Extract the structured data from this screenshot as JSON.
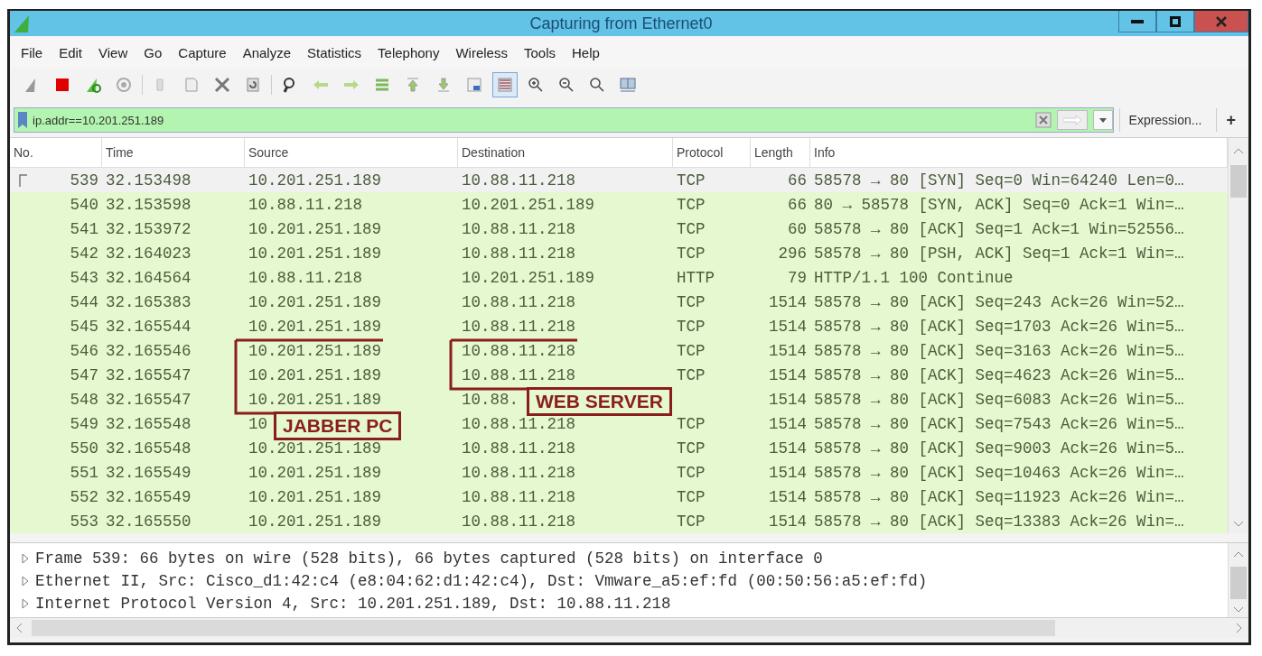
{
  "window": {
    "title": "Capturing from Ethernet0"
  },
  "menu": [
    "File",
    "Edit",
    "View",
    "Go",
    "Capture",
    "Analyze",
    "Statistics",
    "Telephony",
    "Wireless",
    "Tools",
    "Help"
  ],
  "toolbar": [
    {
      "kind": "fin",
      "pressed": false
    },
    {
      "kind": "stop",
      "pressed": false
    },
    {
      "kind": "restart",
      "pressed": false
    },
    {
      "kind": "options",
      "pressed": false
    },
    {
      "kind": "sep"
    },
    {
      "kind": "open",
      "pressed": false
    },
    {
      "kind": "save",
      "pressed": false
    },
    {
      "kind": "close",
      "pressed": false
    },
    {
      "kind": "reload",
      "pressed": false
    },
    {
      "kind": "sep"
    },
    {
      "kind": "find",
      "pressed": false
    },
    {
      "kind": "back",
      "pressed": false
    },
    {
      "kind": "forward",
      "pressed": false
    },
    {
      "kind": "goto",
      "pressed": false
    },
    {
      "kind": "first",
      "pressed": false
    },
    {
      "kind": "last",
      "pressed": false
    },
    {
      "kind": "autoscroll",
      "pressed": false
    },
    {
      "kind": "colorize",
      "pressed": true
    },
    {
      "kind": "zoom-in",
      "pressed": false
    },
    {
      "kind": "zoom-out",
      "pressed": false
    },
    {
      "kind": "zoom-reset",
      "pressed": false
    },
    {
      "kind": "resize",
      "pressed": false
    }
  ],
  "filter": {
    "value": "ip.addr==10.201.251.189",
    "expression_button": "Expression...",
    "add_button": "+"
  },
  "table": {
    "columns": [
      "No.",
      "Time",
      "Source",
      "Destination",
      "Protocol",
      "Length",
      "Info"
    ],
    "rows": [
      {
        "no": "539",
        "time": "32.153498",
        "source": "10.201.251.189",
        "destination": "10.88.11.218",
        "protocol": "TCP",
        "length": "66",
        "info": "58578 → 80 [SYN] Seq=0 Win=64240 Len=0…",
        "selected": true
      },
      {
        "no": "540",
        "time": "32.153598",
        "source": "10.88.11.218",
        "destination": "10.201.251.189",
        "protocol": "TCP",
        "length": "66",
        "info": "80 → 58578 [SYN, ACK] Seq=0 Ack=1 Win=…",
        "selected": false
      },
      {
        "no": "541",
        "time": "32.153972",
        "source": "10.201.251.189",
        "destination": "10.88.11.218",
        "protocol": "TCP",
        "length": "60",
        "info": "58578 → 80 [ACK] Seq=1 Ack=1 Win=52556…",
        "selected": false
      },
      {
        "no": "542",
        "time": "32.164023",
        "source": "10.201.251.189",
        "destination": "10.88.11.218",
        "protocol": "TCP",
        "length": "296",
        "info": "58578 → 80 [PSH, ACK] Seq=1 Ack=1 Win=…",
        "selected": false
      },
      {
        "no": "543",
        "time": "32.164564",
        "source": "10.88.11.218",
        "destination": "10.201.251.189",
        "protocol": "HTTP",
        "length": "79",
        "info": "HTTP/1.1 100 Continue",
        "selected": false
      },
      {
        "no": "544",
        "time": "32.165383",
        "source": "10.201.251.189",
        "destination": "10.88.11.218",
        "protocol": "TCP",
        "length": "1514",
        "info": "58578 → 80 [ACK] Seq=243 Ack=26 Win=52…",
        "selected": false
      },
      {
        "no": "545",
        "time": "32.165544",
        "source": "10.201.251.189",
        "destination": "10.88.11.218",
        "protocol": "TCP",
        "length": "1514",
        "info": "58578 → 80 [ACK] Seq=1703 Ack=26 Win=5…",
        "selected": false
      },
      {
        "no": "546",
        "time": "32.165546",
        "source": "10.201.251.189",
        "destination": "10.88.11.218",
        "protocol": "TCP",
        "length": "1514",
        "info": "58578 → 80 [ACK] Seq=3163 Ack=26 Win=5…",
        "selected": false
      },
      {
        "no": "547",
        "time": "32.165547",
        "source": "10.201.251.189",
        "destination": "10.88.11.218",
        "protocol": "TCP",
        "length": "1514",
        "info": "58578 → 80 [ACK] Seq=4623 Ack=26 Win=5…",
        "selected": false
      },
      {
        "no": "548",
        "time": "32.165547",
        "source": "10.201.251.189",
        "destination": "10.88.",
        "length": "1514",
        "info": "58578 → 80 [ACK] Seq=6083 Ack=26 Win=5…",
        "selected": false
      },
      {
        "no": "549",
        "time": "32.165548",
        "source": "10",
        "destination": "10.88.11.218",
        "protocol": "TCP",
        "length": "1514",
        "info": "58578 → 80 [ACK] Seq=7543 Ack=26 Win=5…",
        "selected": false
      },
      {
        "no": "550",
        "time": "32.165548",
        "source": "10.201.251.189",
        "destination": "10.88.11.218",
        "protocol": "TCP",
        "length": "1514",
        "info": "58578 → 80 [ACK] Seq=9003 Ack=26 Win=5…",
        "selected": false
      },
      {
        "no": "551",
        "time": "32.165549",
        "source": "10.201.251.189",
        "destination": "10.88.11.218",
        "protocol": "TCP",
        "length": "1514",
        "info": "58578 → 80 [ACK] Seq=10463 Ack=26 Win=…",
        "selected": false
      },
      {
        "no": "552",
        "time": "32.165549",
        "source": "10.201.251.189",
        "destination": "10.88.11.218",
        "protocol": "TCP",
        "length": "1514",
        "info": "58578 → 80 [ACK] Seq=11923 Ack=26 Win=…",
        "selected": false
      },
      {
        "no": "553",
        "time": "32.165550",
        "source": "10.201.251.189",
        "destination": "10.88.11.218",
        "protocol": "TCP",
        "length": "1514",
        "info": "58578 → 80 [ACK] Seq=13383 Ack=26 Win=…",
        "selected": false
      }
    ]
  },
  "annotations": [
    {
      "label": "JABBER PC"
    },
    {
      "label": "WEB SERVER"
    }
  ],
  "details": [
    {
      "text": "Frame 539: 66 bytes on wire (528 bits), 66 bytes captured (528 bits) on interface 0",
      "expanded": false
    },
    {
      "text": "Ethernet II, Src: Cisco_d1:42:c4 (e8:04:62:d1:42:c4), Dst: Vmware_a5:ef:fd (00:50:56:a5:ef:fd)",
      "expanded": false
    },
    {
      "text": "Internet Protocol Version 4, Src: 10.201.251.189, Dst: 10.88.11.218",
      "expanded": false
    }
  ]
}
